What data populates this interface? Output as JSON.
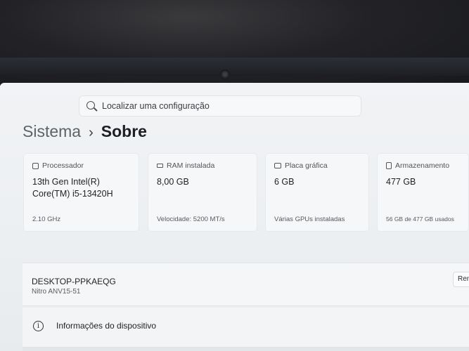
{
  "search": {
    "placeholder": "Localizar uma configuração"
  },
  "breadcrumb": {
    "parent": "Sistema",
    "separator": "›",
    "current": "Sobre"
  },
  "specs": [
    {
      "label": "Processador",
      "icon": "processor-icon",
      "value": "13th Gen Intel(R) Core(TM) i5-13420H",
      "detail": "2.10 GHz"
    },
    {
      "label": "RAM instalada",
      "icon": "ram-icon",
      "value": "8,00 GB",
      "detail": "Velocidade: 5200 MT/s"
    },
    {
      "label": "Placa gráfica",
      "icon": "gpu-icon",
      "value": "6 GB",
      "detail": "Várias GPUs instaladas"
    },
    {
      "label": "Armazenamento",
      "icon": "storage-icon",
      "value": "477 GB",
      "detail": "56 GB de 477 GB usados"
    }
  ],
  "device": {
    "name": "DESKTOP-PPKAEQG",
    "model": "Nitro ANV15-51",
    "rename_label": "Renomear"
  },
  "device_info": {
    "label": "Informações do dispositivo"
  }
}
